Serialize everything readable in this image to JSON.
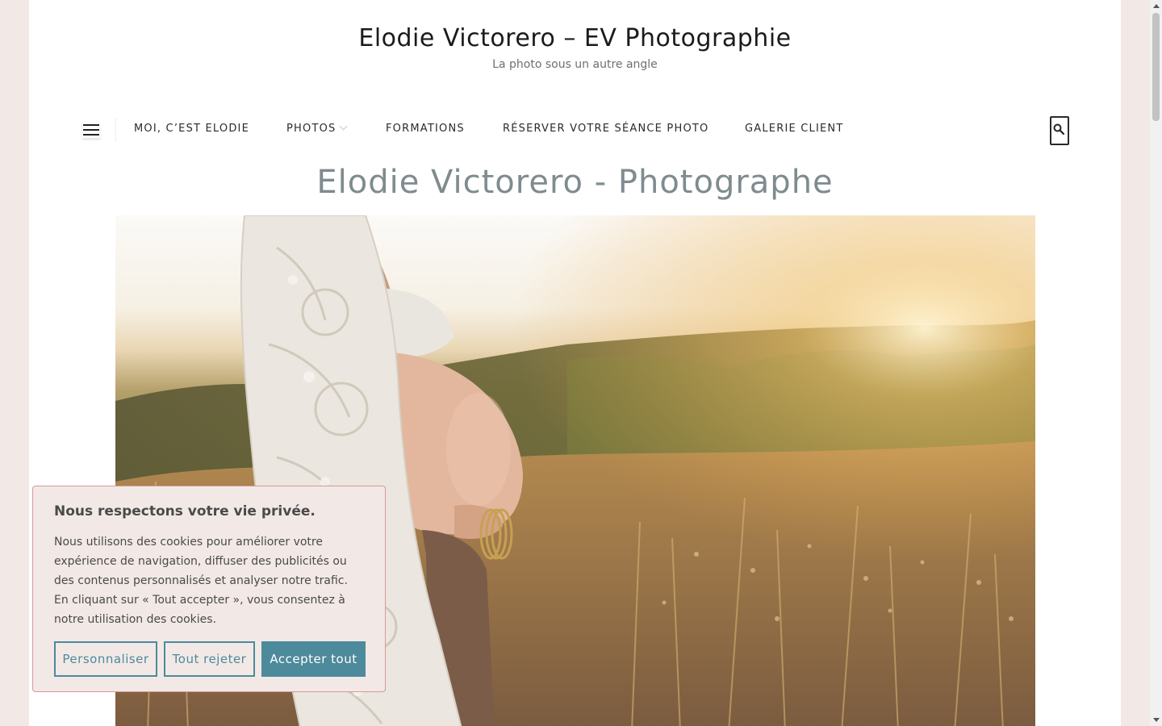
{
  "site": {
    "title": "Elodie Victorero – EV Photographie",
    "tagline": "La photo sous un autre angle"
  },
  "nav": {
    "menu_icon": "hamburger-menu-icon",
    "items": [
      {
        "label": "MOI, C’EST ELODIE"
      },
      {
        "label": "PHOTOS",
        "has_dropdown": true
      },
      {
        "label": "FORMATIONS"
      },
      {
        "label": "RÉSERVER VOTRE SÉANCE PHOTO"
      },
      {
        "label": "GALERIE CLIENT"
      }
    ],
    "search_icon": "search-icon"
  },
  "main": {
    "page_title": "Elodie Victorero - Photographe",
    "hero_image": "pregnant-woman-in-lace-kimono-sunset-field"
  },
  "cookie_banner": {
    "title": "Nous respectons votre vie privée.",
    "text": "Nous utilisons des cookies pour améliorer votre expérience de navigation, diffuser des publicités ou des contenus personnalisés et analyser notre trafic. En cliquant sur « Tout accepter », vous consentez à notre utilisation des cookies.",
    "buttons": {
      "customize": "Personnaliser",
      "reject": "Tout rejeter",
      "accept": "Accepter tout"
    }
  },
  "colors": {
    "background": "#f2e9e6",
    "accent": "#4d8a9b",
    "page_title": "#7f8b8e",
    "cookie_border": "#d49a9a"
  }
}
